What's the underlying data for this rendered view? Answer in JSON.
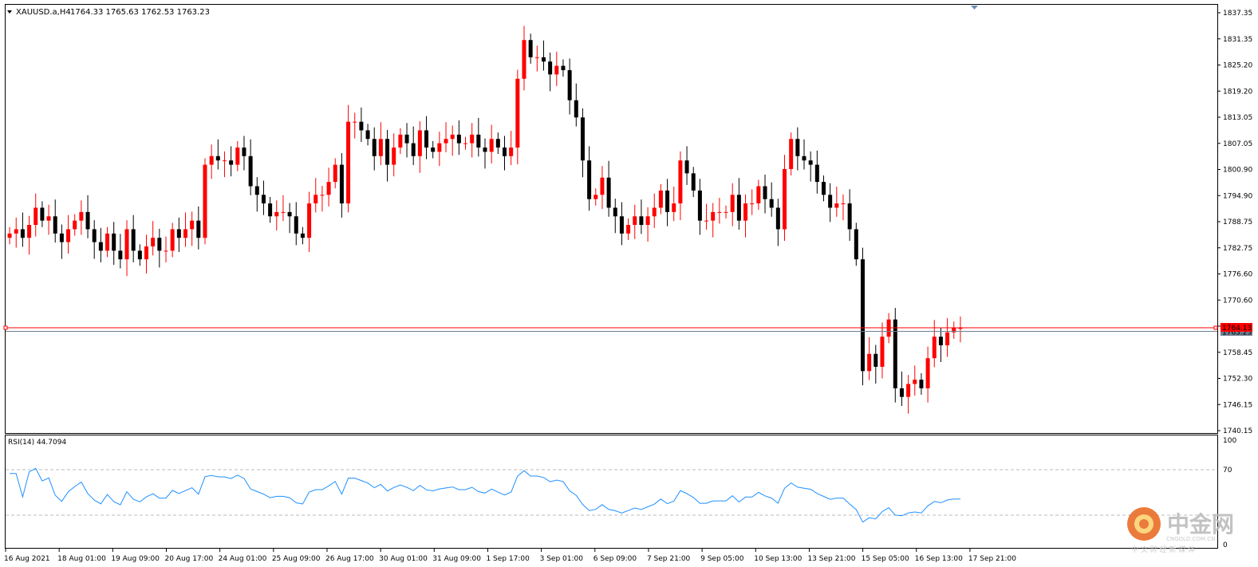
{
  "header": {
    "symbol": "XAUUSD.a,H4",
    "ohlc": "1764.33 1765.63 1762.53 1763.23"
  },
  "rsi": {
    "label": "RSI(14) 44.7094",
    "levels": [
      70,
      30
    ],
    "axis_labels": [
      "100",
      "70",
      "0"
    ]
  },
  "colors": {
    "bull": "#ff0000",
    "bear": "#000000",
    "rsi_line": "#1e90ff",
    "price_line": "#ff0000",
    "ask_line": "#708090",
    "grid": "#bbbbbb"
  },
  "watermark": {
    "title": "中金网",
    "domain": "CNGOLD.COM.CN",
    "tagline": "中 文 财 经 新 媒 体"
  },
  "chart_data": {
    "type": "candlestick",
    "title": "XAUUSD.a,H4",
    "y_range": [
      1740.15,
      1837.35
    ],
    "y_ticks": [
      "1837.35",
      "1831.35",
      "1825.20",
      "1819.20",
      "1813.05",
      "1807.05",
      "1800.90",
      "1794.90",
      "1788.75",
      "1782.75",
      "1776.60",
      "1770.60",
      "1764.45",
      "1758.45",
      "1752.30",
      "1746.15",
      "1740.15"
    ],
    "x_ticks": [
      "16 Aug 2021",
      "18 Aug 01:00",
      "19 Aug 09:00",
      "20 Aug 17:00",
      "24 Aug 01:00",
      "25 Aug 09:00",
      "26 Aug 17:00",
      "30 Aug 01:00",
      "31 Aug 09:00",
      "1 Sep 17:00",
      "3 Sep 01:00",
      "6 Sep 09:00",
      "7 Sep 21:00",
      "9 Sep 05:00",
      "10 Sep 13:00",
      "13 Sep 21:00",
      "15 Sep 05:00",
      "16 Sep 13:00",
      "17 Sep 21:00"
    ],
    "current_price": "1764.13",
    "ask_price": "1763.23",
    "close_series": [
      1786,
      1787,
      1785,
      1788,
      1792,
      1789,
      1790,
      1786,
      1784,
      1787,
      1789,
      1791,
      1787,
      1784,
      1782,
      1786,
      1782,
      1780,
      1787,
      1782,
      1780,
      1783,
      1785,
      1782,
      1782,
      1787,
      1785,
      1787,
      1789,
      1785,
      1802,
      1804,
      1803,
      1803,
      1802,
      1806,
      1804,
      1797,
      1795,
      1793,
      1790,
      1791,
      1791,
      1790,
      1786,
      1785,
      1793,
      1795,
      1795,
      1798,
      1802,
      1793,
      1812,
      1812,
      1810,
      1808,
      1804,
      1808,
      1802,
      1806,
      1809,
      1807,
      1804,
      1810,
      1806,
      1805,
      1807,
      1808,
      1809,
      1807,
      1807,
      1809,
      1806,
      1805,
      1808,
      1806,
      1804,
      1806,
      1822,
      1831,
      1827,
      1827,
      1826,
      1823,
      1825,
      1824,
      1817,
      1813,
      1803,
      1794,
      1795,
      1799,
      1792,
      1790,
      1786,
      1788,
      1790,
      1788,
      1790,
      1792,
      1796,
      1791,
      1793,
      1803,
      1800,
      1796,
      1789,
      1789,
      1791,
      1791,
      1791,
      1795,
      1789,
      1793,
      1793,
      1797,
      1794,
      1792,
      1787,
      1801,
      1808,
      1804,
      1803,
      1802,
      1798,
      1795,
      1792,
      1793,
      1793,
      1787,
      1780,
      1754,
      1758,
      1755,
      1762,
      1766,
      1750,
      1748,
      1751,
      1752,
      1750,
      1757,
      1762,
      1760,
      1763,
      1764,
      1764
    ]
  }
}
